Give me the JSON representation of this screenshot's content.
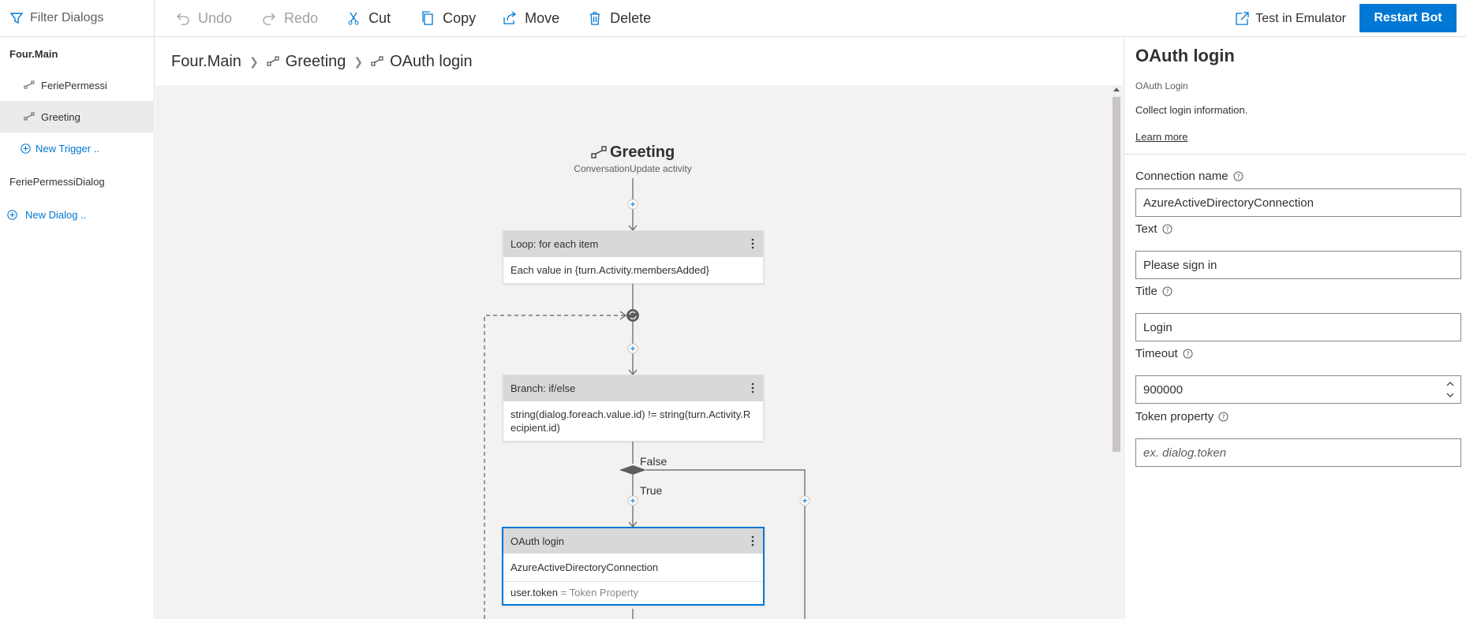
{
  "nav": {
    "filter_label": "Filter Dialogs",
    "dialogs": [
      {
        "label": "Four.Main"
      },
      {
        "label": "FeriePermessi"
      },
      {
        "label": "Greeting"
      },
      {
        "label": "New Trigger .."
      },
      {
        "label": "FeriePermessiDialog"
      },
      {
        "label": "New Dialog .."
      }
    ]
  },
  "toolbar": {
    "undo": "Undo",
    "redo": "Redo",
    "cut": "Cut",
    "copy": "Copy",
    "move": "Move",
    "delete": "Delete",
    "emulator": "Test in Emulator",
    "restart": "Restart Bot"
  },
  "breadcrumb": [
    "Four.Main",
    "Greeting",
    "OAuth login"
  ],
  "flow": {
    "trigger_title": "Greeting",
    "trigger_sub": "ConversationUpdate activity",
    "loop_header": "Loop: for each item",
    "loop_body": "Each value in {turn.Activity.membersAdded}",
    "branch_header": "Branch: if/else",
    "branch_body": "string(dialog.foreach.value.id) != string(turn.Activity.Recipient.id)",
    "false_label": "False",
    "true_label": "True",
    "oauth_header": "OAuth login",
    "oauth_body": "AzureActiveDirectoryConnection",
    "oauth_prop_key": "user.token",
    "oauth_prop_eq": "=",
    "oauth_prop_val": "Token Property"
  },
  "props": {
    "title": "OAuth login",
    "subtitle": "OAuth Login",
    "description": "Collect login information.",
    "learn_more": "Learn more",
    "fields": [
      {
        "label": "Connection name",
        "value": "AzureActiveDirectoryConnection"
      },
      {
        "label": "Text",
        "value": "Please sign in"
      },
      {
        "label": "Title",
        "value": "Login"
      },
      {
        "label": "Timeout",
        "value": "900000"
      },
      {
        "label": "Token property",
        "placeholder": "ex. dialog.token"
      }
    ]
  },
  "colors": {
    "accent": "#0078d4",
    "canvas": "#f3f2f1",
    "node_header": "#d8d8d8"
  }
}
